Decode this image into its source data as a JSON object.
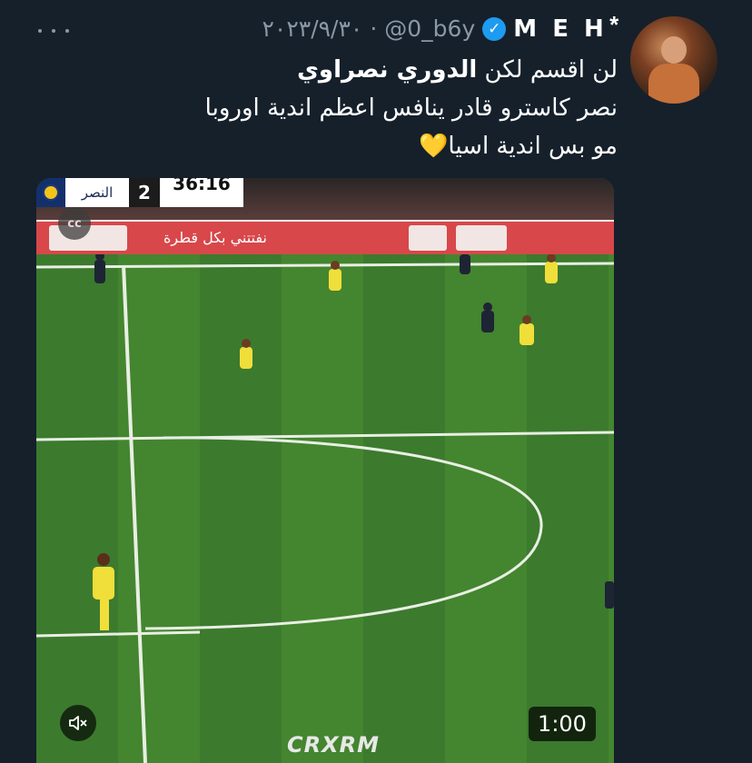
{
  "tweet": {
    "display_name": "M E H ⃰",
    "verified_glyph": "✓",
    "handle": "@0_b6y",
    "separator": "·",
    "date": "٢٠٢٣/٩/٣٠",
    "more_icon": "more-horizontal-icon",
    "text_line1_normal": "لن اقسم لكن ",
    "text_line1_bold": "الدوري نصراوي",
    "text_line2": "نصر كاسترو قادر ينافس اعظم اندية اوروبا",
    "text_line3": "مو بس اندية اسيا",
    "text_emoji": "💛"
  },
  "video": {
    "team_name": "النصر",
    "score": "2",
    "clock": "36:16",
    "ad_text": "نفتتني بكل قطرة",
    "captions_label": "cc",
    "mute_icon": "volume-mute-icon",
    "duration": "1:00",
    "watermark": "CRXRM"
  }
}
